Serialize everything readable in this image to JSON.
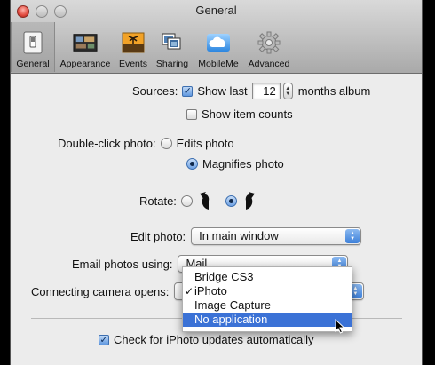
{
  "window": {
    "title": "General"
  },
  "toolbar": {
    "items": [
      {
        "label": "General",
        "icon": "general-switch-icon",
        "selected": true
      },
      {
        "label": "Appearance",
        "icon": "appearance-icon",
        "selected": false
      },
      {
        "label": "Events",
        "icon": "events-icon",
        "selected": false
      },
      {
        "label": "Sharing",
        "icon": "sharing-icon",
        "selected": false
      },
      {
        "label": "MobileMe",
        "icon": "mobileme-cloud-icon",
        "selected": false
      },
      {
        "label": "Advanced",
        "icon": "advanced-gear-icon",
        "selected": false
      }
    ]
  },
  "general": {
    "sources_label": "Sources:",
    "show_last_label": "Show last",
    "show_last_checked": true,
    "months_value": "12",
    "months_album_label": "months album",
    "show_item_counts_label": "Show item counts",
    "show_item_counts_checked": false,
    "double_click_label": "Double-click photo:",
    "edits_photo_label": "Edits photo",
    "magnifies_photo_label": "Magnifies photo",
    "double_click_selected": "Magnifies photo",
    "rotate_label": "Rotate:",
    "rotate_selected": "clockwise",
    "edit_photo_label": "Edit photo:",
    "edit_photo_value": "In main window",
    "email_photos_label": "Email photos using:",
    "email_photos_value": "Mail",
    "camera_opens_label": "Connecting camera opens:",
    "check_updates_label": "Check for iPhoto updates automatically",
    "check_updates_checked": true
  },
  "camera_menu": {
    "items": [
      {
        "label": "Bridge CS3",
        "checked": false,
        "highlighted": false
      },
      {
        "label": "iPhoto",
        "checked": true,
        "highlighted": false
      },
      {
        "label": "Image Capture",
        "checked": false,
        "highlighted": false
      },
      {
        "label": "No application",
        "checked": false,
        "highlighted": true
      }
    ]
  },
  "colors": {
    "accent": "#3b72d6",
    "close_button": "#e24b3f"
  }
}
